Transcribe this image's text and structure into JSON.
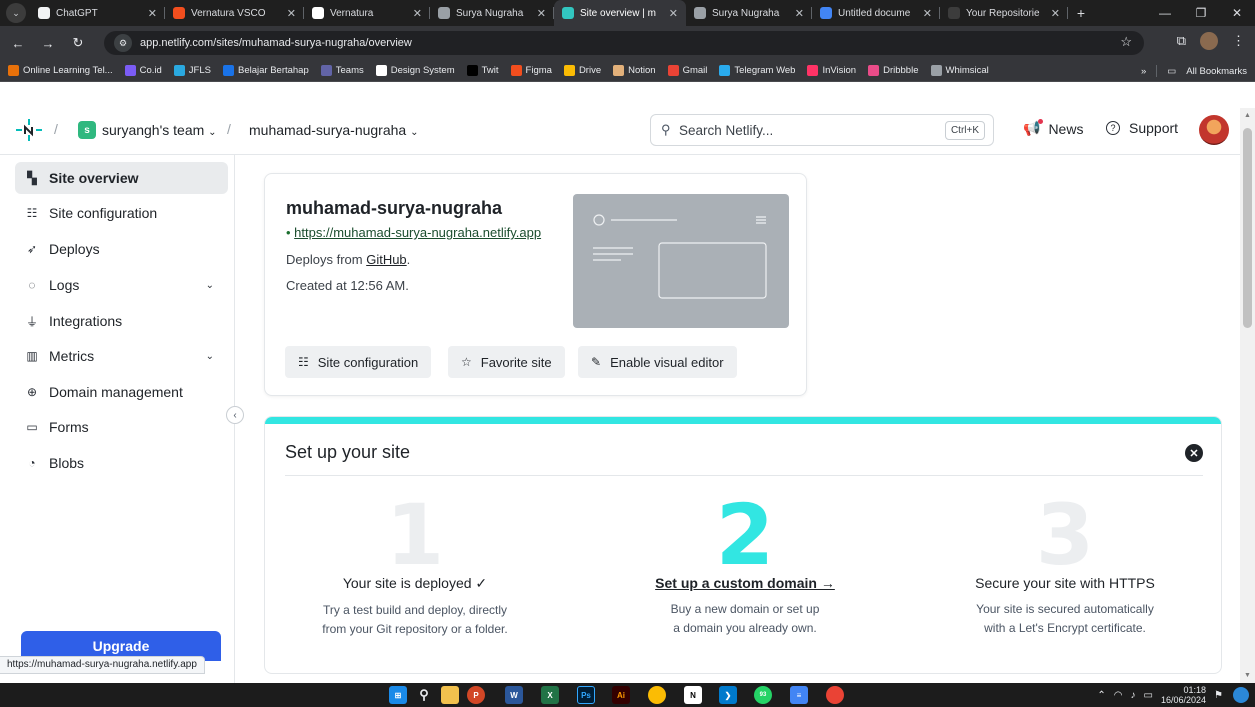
{
  "browser": {
    "tabs": [
      {
        "title": "ChatGPT",
        "favicon_color": "#f1f3f4",
        "active": false
      },
      {
        "title": "Vernatura VSCO",
        "favicon_color": "#f24e1e",
        "active": false
      },
      {
        "title": "Vernatura",
        "favicon_color": "#ffffff",
        "active": false
      },
      {
        "title": "Surya Nugraha",
        "favicon_color": "#9aa0a6",
        "active": false
      },
      {
        "title": "Site overview | m",
        "favicon_color": "#32c6c0",
        "active": true
      },
      {
        "title": "Surya Nugraha",
        "favicon_color": "#9aa0a6",
        "active": false
      },
      {
        "title": "Untitled docume",
        "favicon_color": "#4285f4",
        "active": false
      },
      {
        "title": "Your Repositorie",
        "favicon_color": "#3c3c3c",
        "active": false
      }
    ],
    "new_tab": "+",
    "address": "app.netlify.com/sites/muhamad-surya-nugraha/overview",
    "bookmarks": [
      {
        "label": "Online Learning Tel...",
        "color": "#e8710a"
      },
      {
        "label": "Co.id",
        "color": "#7b5cf5"
      },
      {
        "label": "JFLS",
        "color": "#2aa9e0"
      },
      {
        "label": "Belajar Bertahap",
        "color": "#1a73e8"
      },
      {
        "label": "Teams",
        "color": "#6264a7"
      },
      {
        "label": "Design System",
        "color": "#ffffff"
      },
      {
        "label": "Twit",
        "color": "#000000"
      },
      {
        "label": "Figma",
        "color": "#f24e1e"
      },
      {
        "label": "Drive",
        "color": "#fbbc04"
      },
      {
        "label": "Notion",
        "color": "#e2b07a"
      },
      {
        "label": "Gmail",
        "color": "#ea4335"
      },
      {
        "label": "Telegram Web",
        "color": "#2aabee"
      },
      {
        "label": "InVision",
        "color": "#ff3366"
      },
      {
        "label": "Dribbble",
        "color": "#ea4c89"
      },
      {
        "label": "Whimsical",
        "color": "#9aa0a6"
      }
    ],
    "bookmarks_overflow": "»",
    "all_bookmarks": "All Bookmarks"
  },
  "header": {
    "team_initial": "s",
    "team_name": "suryangh's team",
    "site_name": "muhamad-surya-nugraha",
    "search_placeholder": "Search Netlify...",
    "search_shortcut": "Ctrl+K",
    "news_label": "News",
    "support_label": "Support"
  },
  "sidebar": {
    "items": [
      {
        "label": "Site overview",
        "icon": "grid-icon",
        "glyph": "▚",
        "active": true,
        "has_chevron": false
      },
      {
        "label": "Site configuration",
        "icon": "config-icon",
        "glyph": "☷",
        "active": false,
        "has_chevron": false
      },
      {
        "label": "Deploys",
        "icon": "rocket-icon",
        "glyph": "➶",
        "active": false,
        "has_chevron": false
      },
      {
        "label": "Logs",
        "icon": "logs-icon",
        "glyph": "◌",
        "active": false,
        "has_chevron": true
      },
      {
        "label": "Integrations",
        "icon": "plug-icon",
        "glyph": "⏚",
        "active": false,
        "has_chevron": false
      },
      {
        "label": "Metrics",
        "icon": "bar-chart-icon",
        "glyph": "▥",
        "active": false,
        "has_chevron": true
      },
      {
        "label": "Domain management",
        "icon": "globe-icon",
        "glyph": "⊕",
        "active": false,
        "has_chevron": false
      },
      {
        "label": "Forms",
        "icon": "forms-icon",
        "glyph": "▭",
        "active": false,
        "has_chevron": false
      },
      {
        "label": "Blobs",
        "icon": "blobs-icon",
        "glyph": "◔",
        "active": false,
        "has_chevron": false
      }
    ],
    "upgrade_label": "Upgrade",
    "status_url": "https://muhamad-surya-nugraha.netlify.app"
  },
  "site_card": {
    "title": "muhamad-surya-nugraha",
    "url": "https://muhamad-surya-nugraha.netlify.app",
    "deploys_prefix": "Deploys from ",
    "deploys_source": "GitHub",
    "deploys_suffix": ".",
    "created": "Created at 12:56 AM.",
    "buttons": {
      "site_config": "Site configuration",
      "favorite": "Favorite site",
      "visual_editor": "Enable visual editor"
    }
  },
  "setup": {
    "title": "Set up your site",
    "steps": [
      {
        "number": "1",
        "title": "Your site is deployed ✓",
        "description": "Try a test build and deploy, directly\nfrom your Git repository or a folder.",
        "active": false
      },
      {
        "number": "2",
        "title": "Set up a custom domain →",
        "description": "Buy a new domain or set up\na domain you already own.",
        "active": true
      },
      {
        "number": "3",
        "title": "Secure your site with HTTPS",
        "description": "Your site is secured automatically\nwith a Let's Encrypt certificate.",
        "active": false
      }
    ]
  },
  "taskbar": {
    "time": "01:18",
    "date": "16/06/2024",
    "badge_count": "93"
  },
  "colors": {
    "accent_teal": "#32e6e2",
    "upgrade_blue": "#2f5fe8",
    "link_green": "#1b4d2e"
  }
}
